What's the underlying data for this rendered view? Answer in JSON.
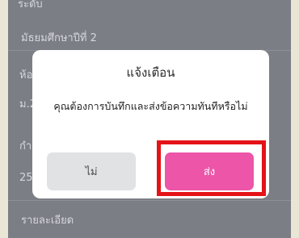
{
  "background": {
    "top_label": "ระดับ",
    "level_value": "มัธยมศึกษาปีที่ 2",
    "room_label": "ห้อ",
    "room_value": "ม.2",
    "time_label": "กำ",
    "time_value": "25",
    "details_label": "รายละเอียด"
  },
  "dialog": {
    "title": "แจ้งเตือน",
    "message": "คุณต้องการบันทึกและส่งข้อความทันทีหรือไม่",
    "no_label": "ไม่",
    "send_label": "ส่ง"
  },
  "colors": {
    "overlay": "#7c7e86",
    "send_button": "#ec55a8",
    "no_button": "#e1e2e4",
    "highlight_border": "#e31318"
  }
}
